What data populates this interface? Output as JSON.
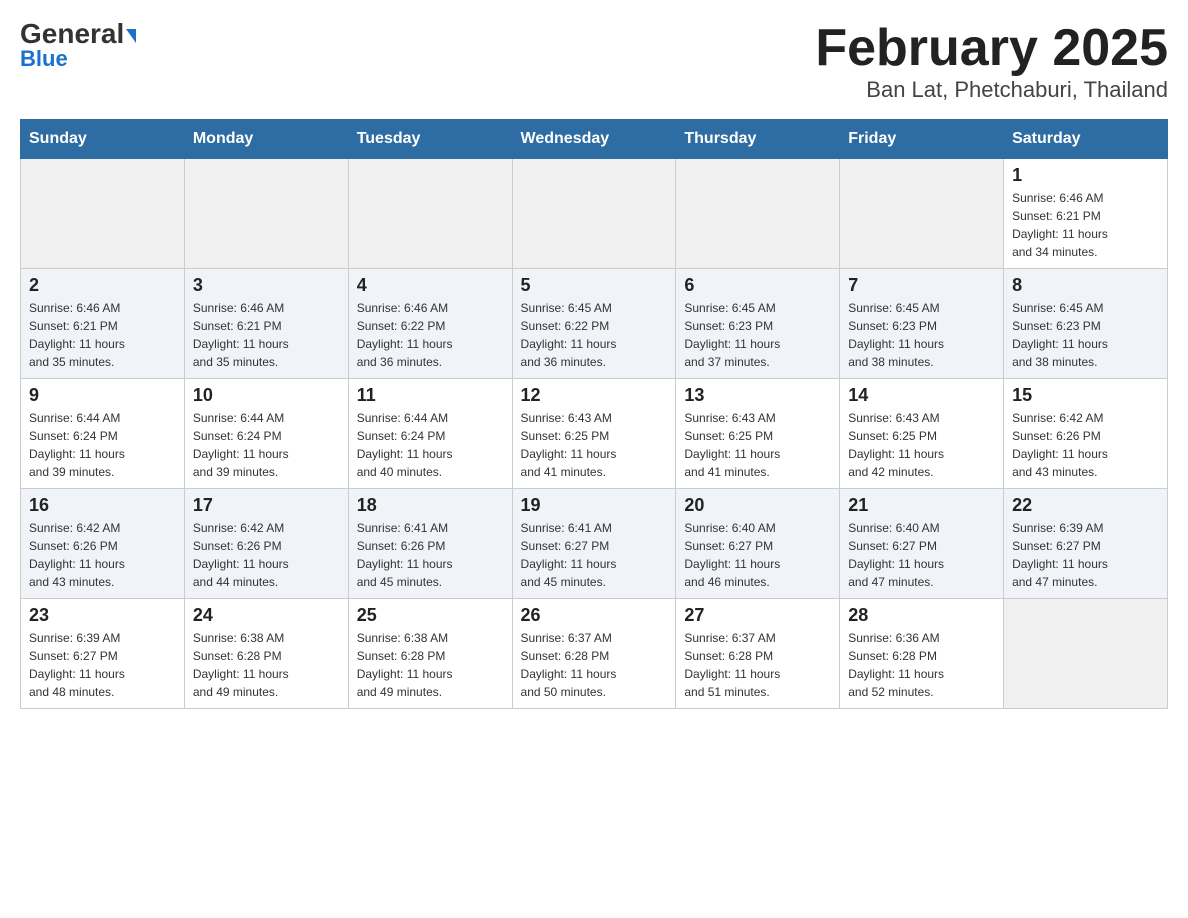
{
  "header": {
    "logo_general": "General",
    "logo_blue": "Blue",
    "title": "February 2025",
    "subtitle": "Ban Lat, Phetchaburi, Thailand"
  },
  "weekdays": [
    "Sunday",
    "Monday",
    "Tuesday",
    "Wednesday",
    "Thursday",
    "Friday",
    "Saturday"
  ],
  "weeks": [
    [
      {
        "num": "",
        "info": ""
      },
      {
        "num": "",
        "info": ""
      },
      {
        "num": "",
        "info": ""
      },
      {
        "num": "",
        "info": ""
      },
      {
        "num": "",
        "info": ""
      },
      {
        "num": "",
        "info": ""
      },
      {
        "num": "1",
        "info": "Sunrise: 6:46 AM\nSunset: 6:21 PM\nDaylight: 11 hours\nand 34 minutes."
      }
    ],
    [
      {
        "num": "2",
        "info": "Sunrise: 6:46 AM\nSunset: 6:21 PM\nDaylight: 11 hours\nand 35 minutes."
      },
      {
        "num": "3",
        "info": "Sunrise: 6:46 AM\nSunset: 6:21 PM\nDaylight: 11 hours\nand 35 minutes."
      },
      {
        "num": "4",
        "info": "Sunrise: 6:46 AM\nSunset: 6:22 PM\nDaylight: 11 hours\nand 36 minutes."
      },
      {
        "num": "5",
        "info": "Sunrise: 6:45 AM\nSunset: 6:22 PM\nDaylight: 11 hours\nand 36 minutes."
      },
      {
        "num": "6",
        "info": "Sunrise: 6:45 AM\nSunset: 6:23 PM\nDaylight: 11 hours\nand 37 minutes."
      },
      {
        "num": "7",
        "info": "Sunrise: 6:45 AM\nSunset: 6:23 PM\nDaylight: 11 hours\nand 38 minutes."
      },
      {
        "num": "8",
        "info": "Sunrise: 6:45 AM\nSunset: 6:23 PM\nDaylight: 11 hours\nand 38 minutes."
      }
    ],
    [
      {
        "num": "9",
        "info": "Sunrise: 6:44 AM\nSunset: 6:24 PM\nDaylight: 11 hours\nand 39 minutes."
      },
      {
        "num": "10",
        "info": "Sunrise: 6:44 AM\nSunset: 6:24 PM\nDaylight: 11 hours\nand 39 minutes."
      },
      {
        "num": "11",
        "info": "Sunrise: 6:44 AM\nSunset: 6:24 PM\nDaylight: 11 hours\nand 40 minutes."
      },
      {
        "num": "12",
        "info": "Sunrise: 6:43 AM\nSunset: 6:25 PM\nDaylight: 11 hours\nand 41 minutes."
      },
      {
        "num": "13",
        "info": "Sunrise: 6:43 AM\nSunset: 6:25 PM\nDaylight: 11 hours\nand 41 minutes."
      },
      {
        "num": "14",
        "info": "Sunrise: 6:43 AM\nSunset: 6:25 PM\nDaylight: 11 hours\nand 42 minutes."
      },
      {
        "num": "15",
        "info": "Sunrise: 6:42 AM\nSunset: 6:26 PM\nDaylight: 11 hours\nand 43 minutes."
      }
    ],
    [
      {
        "num": "16",
        "info": "Sunrise: 6:42 AM\nSunset: 6:26 PM\nDaylight: 11 hours\nand 43 minutes."
      },
      {
        "num": "17",
        "info": "Sunrise: 6:42 AM\nSunset: 6:26 PM\nDaylight: 11 hours\nand 44 minutes."
      },
      {
        "num": "18",
        "info": "Sunrise: 6:41 AM\nSunset: 6:26 PM\nDaylight: 11 hours\nand 45 minutes."
      },
      {
        "num": "19",
        "info": "Sunrise: 6:41 AM\nSunset: 6:27 PM\nDaylight: 11 hours\nand 45 minutes."
      },
      {
        "num": "20",
        "info": "Sunrise: 6:40 AM\nSunset: 6:27 PM\nDaylight: 11 hours\nand 46 minutes."
      },
      {
        "num": "21",
        "info": "Sunrise: 6:40 AM\nSunset: 6:27 PM\nDaylight: 11 hours\nand 47 minutes."
      },
      {
        "num": "22",
        "info": "Sunrise: 6:39 AM\nSunset: 6:27 PM\nDaylight: 11 hours\nand 47 minutes."
      }
    ],
    [
      {
        "num": "23",
        "info": "Sunrise: 6:39 AM\nSunset: 6:27 PM\nDaylight: 11 hours\nand 48 minutes."
      },
      {
        "num": "24",
        "info": "Sunrise: 6:38 AM\nSunset: 6:28 PM\nDaylight: 11 hours\nand 49 minutes."
      },
      {
        "num": "25",
        "info": "Sunrise: 6:38 AM\nSunset: 6:28 PM\nDaylight: 11 hours\nand 49 minutes."
      },
      {
        "num": "26",
        "info": "Sunrise: 6:37 AM\nSunset: 6:28 PM\nDaylight: 11 hours\nand 50 minutes."
      },
      {
        "num": "27",
        "info": "Sunrise: 6:37 AM\nSunset: 6:28 PM\nDaylight: 11 hours\nand 51 minutes."
      },
      {
        "num": "28",
        "info": "Sunrise: 6:36 AM\nSunset: 6:28 PM\nDaylight: 11 hours\nand 52 minutes."
      },
      {
        "num": "",
        "info": ""
      }
    ]
  ]
}
